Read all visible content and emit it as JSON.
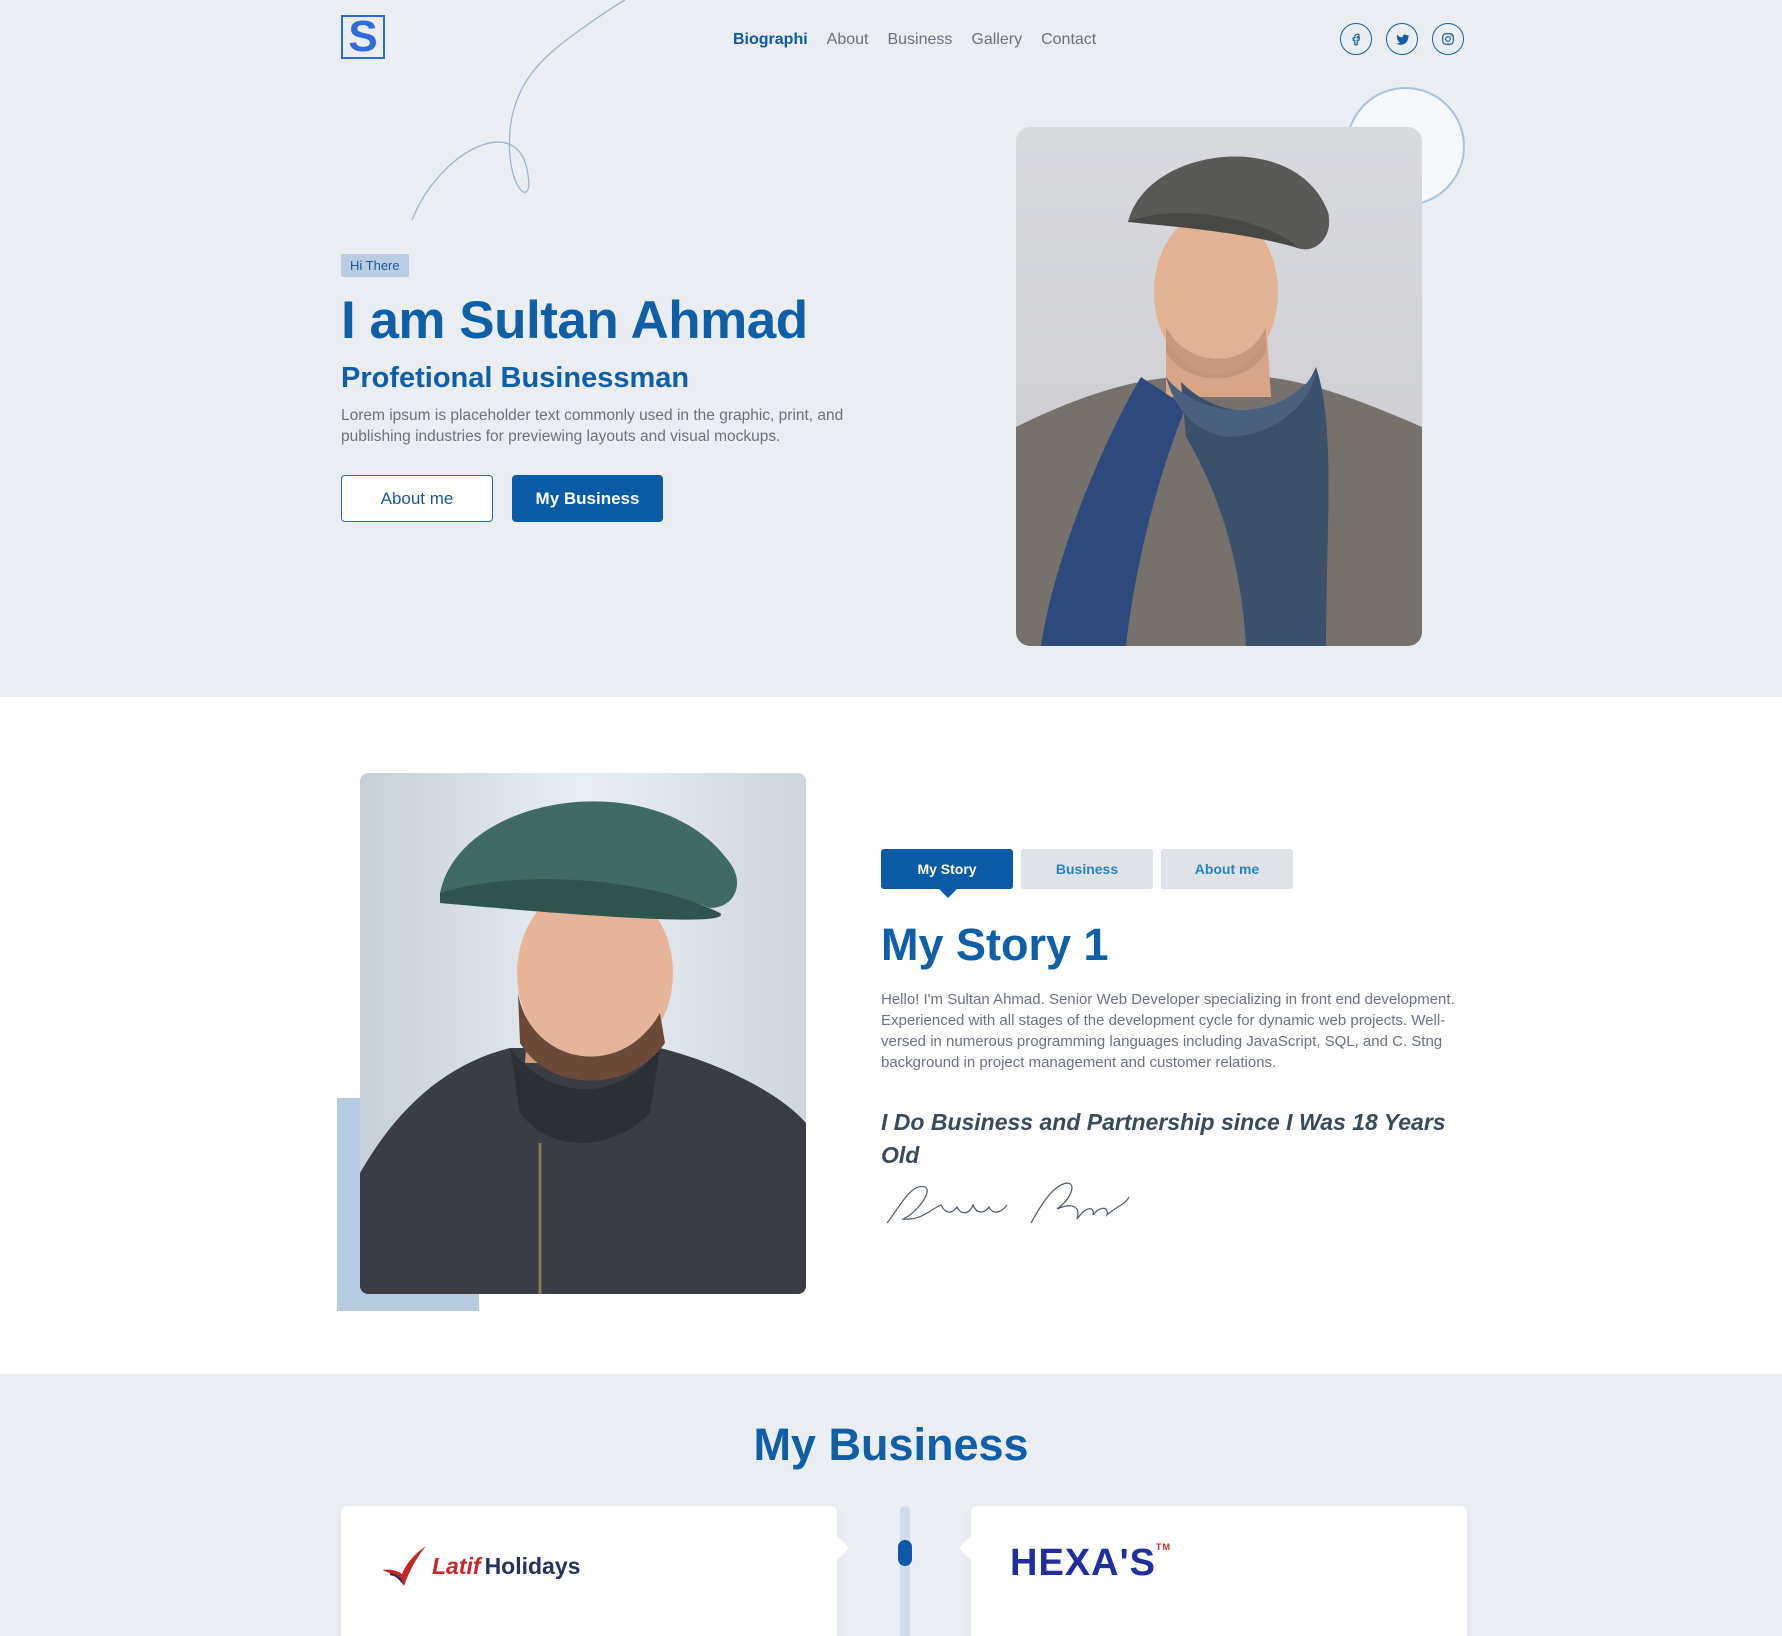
{
  "header": {
    "logo_letter": "S",
    "nav": [
      {
        "label": "Biographi",
        "active": true
      },
      {
        "label": "About",
        "active": false
      },
      {
        "label": "Business",
        "active": false
      },
      {
        "label": "Gallery",
        "active": false
      },
      {
        "label": "Contact",
        "active": false
      }
    ],
    "social_icons": [
      "facebook-icon",
      "twitter-icon",
      "instagram-icon"
    ]
  },
  "hero": {
    "badge": "Hi There",
    "title": "I am Sultan Ahmad",
    "subtitle": "Profetional Businessman",
    "description": "Lorem ipsum is placeholder text commonly used in the graphic, print, and publishing industries for previewing layouts and visual mockups.",
    "btn_about": "About me",
    "btn_business": "My Business"
  },
  "story": {
    "tabs": [
      {
        "label": "My Story",
        "active": true
      },
      {
        "label": "Business",
        "active": false
      },
      {
        "label": "About me",
        "active": false
      }
    ],
    "title": "My Story 1",
    "text": "Hello! I'm Sultan Ahmad. Senior Web Developer specializing in front end development. Experienced with all stages of the development cycle for dynamic web projects. Well-versed in numerous programming languages including JavaScript, SQL, and C. Stng background in project management and customer relations.",
    "quote": "I Do Business and Partnership since I Was 18 Years Old",
    "signature": "Sultan Ahmed"
  },
  "business": {
    "title": "My Business",
    "cards": [
      {
        "logo_part1": "Latif",
        "logo_part2": "Holidays"
      },
      {
        "logo": "HEXA'S",
        "mark": "TM"
      }
    ]
  },
  "colors": {
    "primary": "#0b5aa7",
    "hero_bg": "#eaedf2",
    "text_muted": "#6b7280"
  }
}
